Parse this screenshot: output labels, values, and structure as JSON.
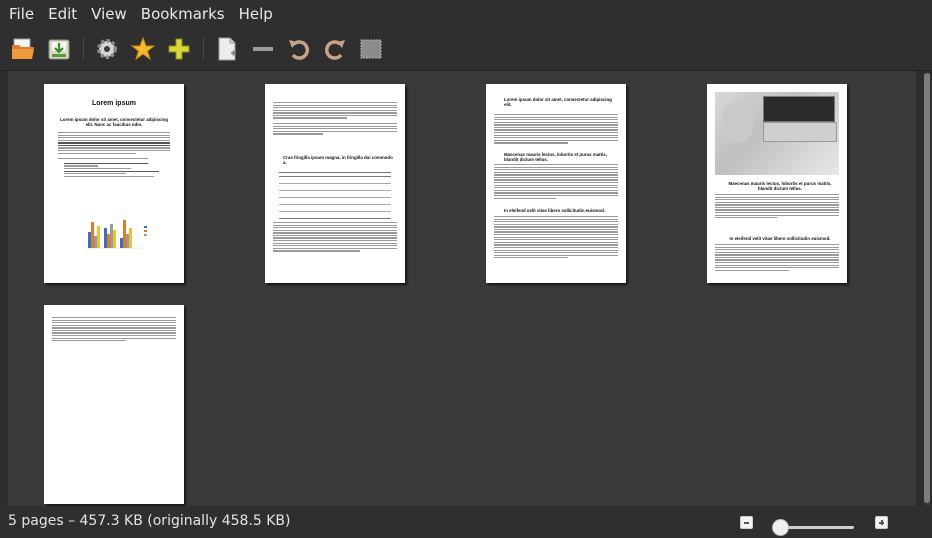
{
  "menubar": {
    "items": [
      "File",
      "Edit",
      "View",
      "Bookmarks",
      "Help"
    ]
  },
  "toolbar": {
    "buttons": [
      "open-icon",
      "export-icon",
      "settings-icon",
      "bookmark-star-icon",
      "insert-plus-icon",
      "duplicate-page-icon",
      "delete-page-icon",
      "rotate-left-icon",
      "rotate-right-icon",
      "crop-icon"
    ]
  },
  "pages": {
    "p1": {
      "title": "Lorem ipsum",
      "subtitle": "Lorem ipsum dolor sit amet, consectetur adipiscing elit. Nunc ac faucibus odio."
    },
    "p2": {
      "heading": "Cras fringilla ipsum magna, in fringilla dui commodo a."
    },
    "p3": {
      "heading1": "Lorem ipsum dolor sit amet, consectetur adipiscing elit.",
      "heading2": "Maecenas mauris lectus, lobortis et purus mattis, blandit dictum tellus.",
      "heading3": "In eleifend velit vitae libero sollicitudin euismod."
    },
    "p4": {
      "heading1": "Maecenas mauris lectus, lobortis et purus mattis, blandit dictum tellus.",
      "heading2": "In eleifend velit vitae libero sollicitudin euismod."
    }
  },
  "status": {
    "text": "5 pages – 457.3 KB (originally 458.5 KB)"
  },
  "zoom": {
    "level": 0.05
  }
}
